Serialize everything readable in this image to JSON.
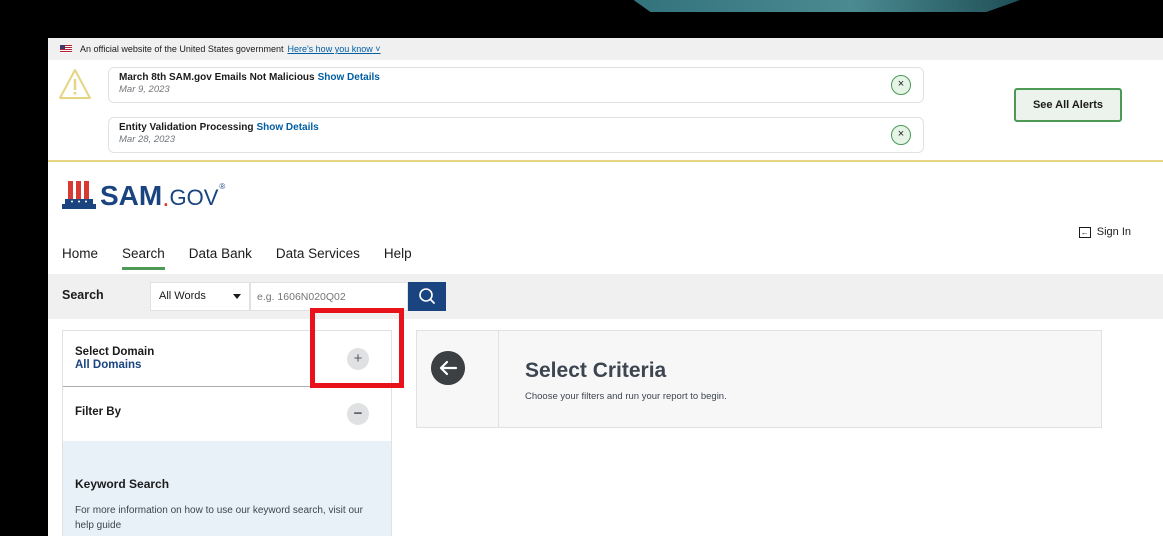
{
  "gov_banner": {
    "text": "An official website of the United States government",
    "link": "Here's how you know"
  },
  "alerts": {
    "items": [
      {
        "title": "March 8th SAM.gov Emails Not Malicious",
        "details_link": "Show Details",
        "date": "Mar 9, 2023"
      },
      {
        "title": "Entity Validation Processing",
        "details_link": "Show Details",
        "date": "Mar 28, 2023"
      }
    ],
    "dismiss_glyph": "×",
    "see_all_label": "See All Alerts",
    "icon": "warning-icon"
  },
  "header": {
    "logo_sam": "SAM",
    "logo_dot": ".",
    "logo_gov": "GOV",
    "logo_reg": "®",
    "sign_in": "Sign In"
  },
  "nav": {
    "items": [
      "Home",
      "Search",
      "Data Bank",
      "Data Services",
      "Help"
    ],
    "active": "Search"
  },
  "search": {
    "label": "Search",
    "scope": "All Words",
    "placeholder": "e.g. 1606N020Q02",
    "button_icon": "search-icon"
  },
  "sidebar": {
    "domain_label": "Select Domain",
    "domain_value": "All Domains",
    "expand_glyph": "+",
    "filter_label": "Filter By",
    "collapse_glyph": "−",
    "keyword_heading": "Keyword Search",
    "keyword_text": "For more information on how to use our keyword search, visit our help guide"
  },
  "criteria": {
    "title": "Select Criteria",
    "subtitle": "Choose your filters and run your report to begin."
  },
  "colors": {
    "brand_blue": "#1a4480",
    "link_blue": "#005ea2",
    "accent_green": "#4c9a55",
    "highlight_red": "#e8121b",
    "alert_border": "#e5d581"
  }
}
